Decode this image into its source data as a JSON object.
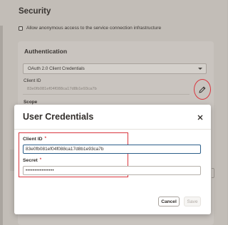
{
  "page": {
    "security_title": "Security",
    "anon_access_label": "Allow anonymous access to the service connection infrastructure",
    "anon_access_checked": false
  },
  "auth": {
    "title": "Authentication",
    "type_selected": "OAuth 2.0 Client Credentials",
    "client_id_label": "Client ID",
    "client_id_value": "83e0fb081ef04f088ca17d8b1e93ca7b",
    "scope_label": "Scope",
    "edit_icon": "pencil-icon"
  },
  "dialog": {
    "title": "User Credentials",
    "close_icon": "close-icon",
    "client_id_label": "Client ID",
    "client_id_required": "*",
    "client_id_value": "83e0fb081ef04f088ca17d8b1e93ca7b",
    "secret_label": "Secret",
    "secret_required": "*",
    "secret_value": "••••••••••••••••",
    "cancel_label": "Cancel",
    "save_label": "Save"
  },
  "colors": {
    "highlight": "#d9363e",
    "focus_border": "#2c5f8a",
    "overlay": "#c2bdb7"
  }
}
